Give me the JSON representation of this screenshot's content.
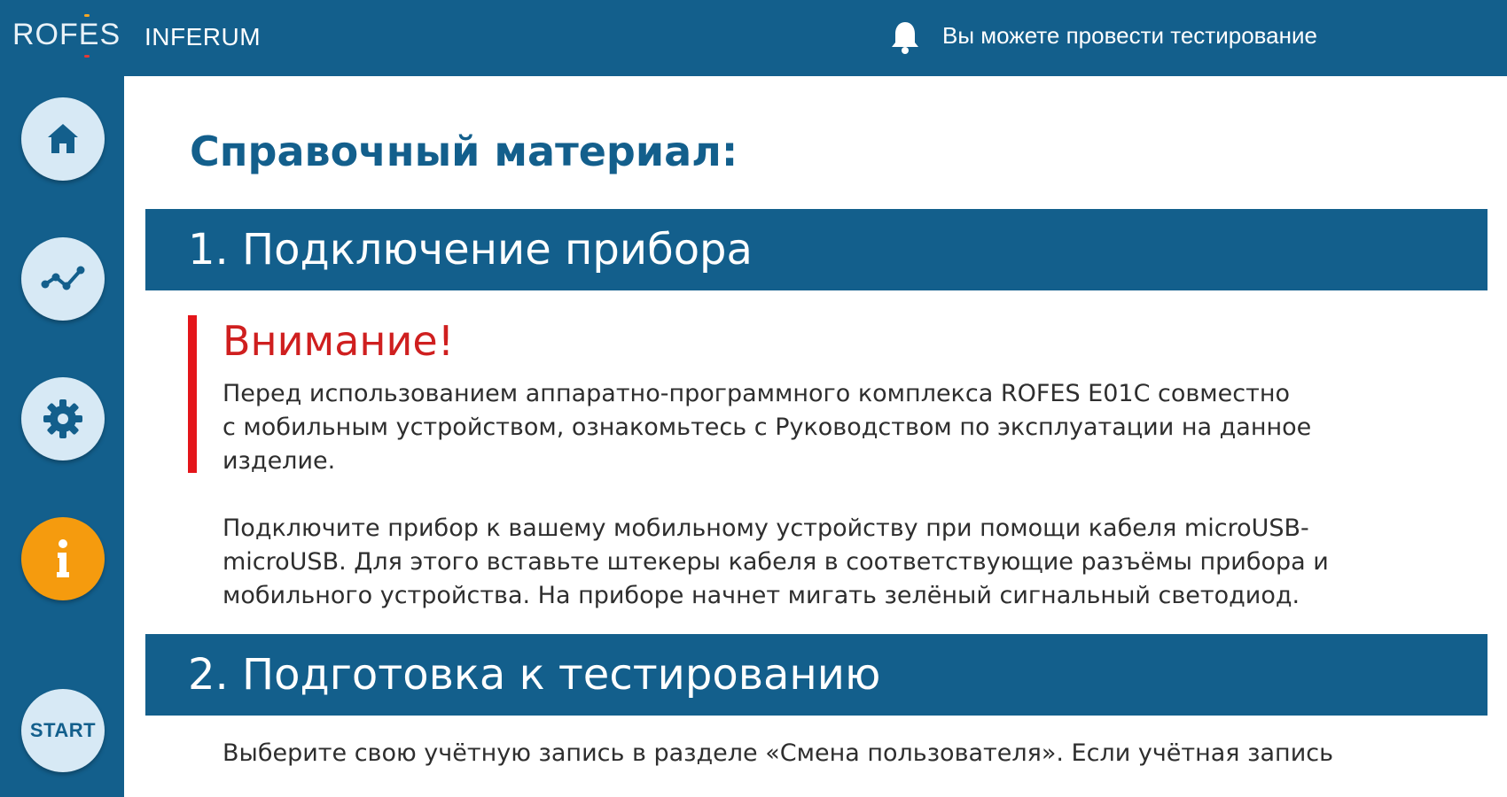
{
  "header": {
    "logo": "ROFES",
    "logo_prefix": "ROF",
    "logo_letter": "E",
    "logo_suffix": "S",
    "app_name": "INFERUM",
    "notice_icon": "bell-icon",
    "notice_text": "Вы можете провести тестирование"
  },
  "sidebar": {
    "items": [
      {
        "icon": "home-icon",
        "active": false
      },
      {
        "icon": "chart-line-icon",
        "active": false
      },
      {
        "icon": "gear-icon",
        "active": false
      },
      {
        "icon": "info-icon",
        "active": true
      },
      {
        "icon": "start-icon",
        "label": "START",
        "active": false
      }
    ]
  },
  "main": {
    "title": "Справочный материал:",
    "sections": [
      {
        "heading": "1. Подключение прибора",
        "alert": {
          "title": "Внимание!",
          "lines": [
            "Перед использованием аппаратно-программного комплекса ROFES E01C совместно",
            "с мобильным устройством, ознакомьтесь с Руководством по эксплуатации на данное",
            "изделие."
          ]
        },
        "lines": [
          "Подключите прибор к вашему мобильному устройству при помощи кабеля microUSB-",
          "microUSB. Для этого вставьте штекеры кабеля в соответствующие разъёмы прибора и",
          "мобильного устройства. На приборе начнет мигать зелёный сигнальный светодиод."
        ]
      },
      {
        "heading": "2. Подготовка к тестированию",
        "lines": [
          "Выберите свою учётную запись в разделе «Смена пользователя». Если учётная запись"
        ]
      }
    ]
  },
  "colors": {
    "primary": "#135f8c",
    "nav_button": "#d7e9f5",
    "active_button": "#f59b0e",
    "alert": "#e4151a",
    "alert_title": "#cf1f1f",
    "text": "#2e2e2e"
  }
}
